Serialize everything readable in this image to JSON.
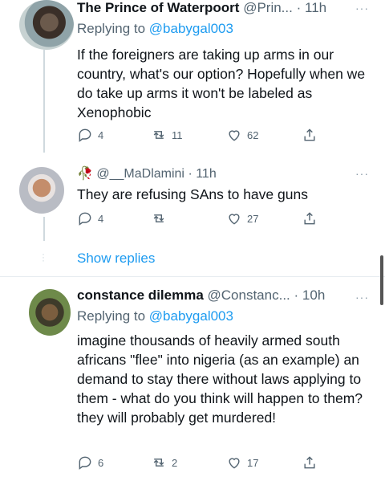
{
  "tweets": [
    {
      "name": "The Prince of Waterpoort",
      "handle": "@Prin...",
      "time": "11h",
      "replying_prefix": "Replying to",
      "replying_handle": "@babygal003",
      "text": "If the foreigners are taking up arms in our country,  what's our option? Hopefully when we do take up arms it won't be labeled as Xenophobic",
      "replies": "4",
      "retweets": "11",
      "likes": "62"
    },
    {
      "name_prefix": "🥀",
      "handle": "@__MaDlamini",
      "time": "11h",
      "text": "They are refusing SAns to have guns",
      "replies": "4",
      "retweets": "",
      "likes": "27"
    },
    {
      "name": "constance dilemma",
      "handle": "@Constanc...",
      "time": "10h",
      "replying_prefix": "Replying to",
      "replying_handle": "@babygal003",
      "text": "imagine thousands of heavily armed south africans \"flee\" into nigeria (as an example) an demand to stay there without laws applying to them - what do you think will happen to them? they will probably get murdered!",
      "replies": "6",
      "retweets": "2",
      "likes": "17"
    }
  ],
  "show_replies": "Show replies",
  "more_glyph": "···",
  "dot_sep": "·"
}
